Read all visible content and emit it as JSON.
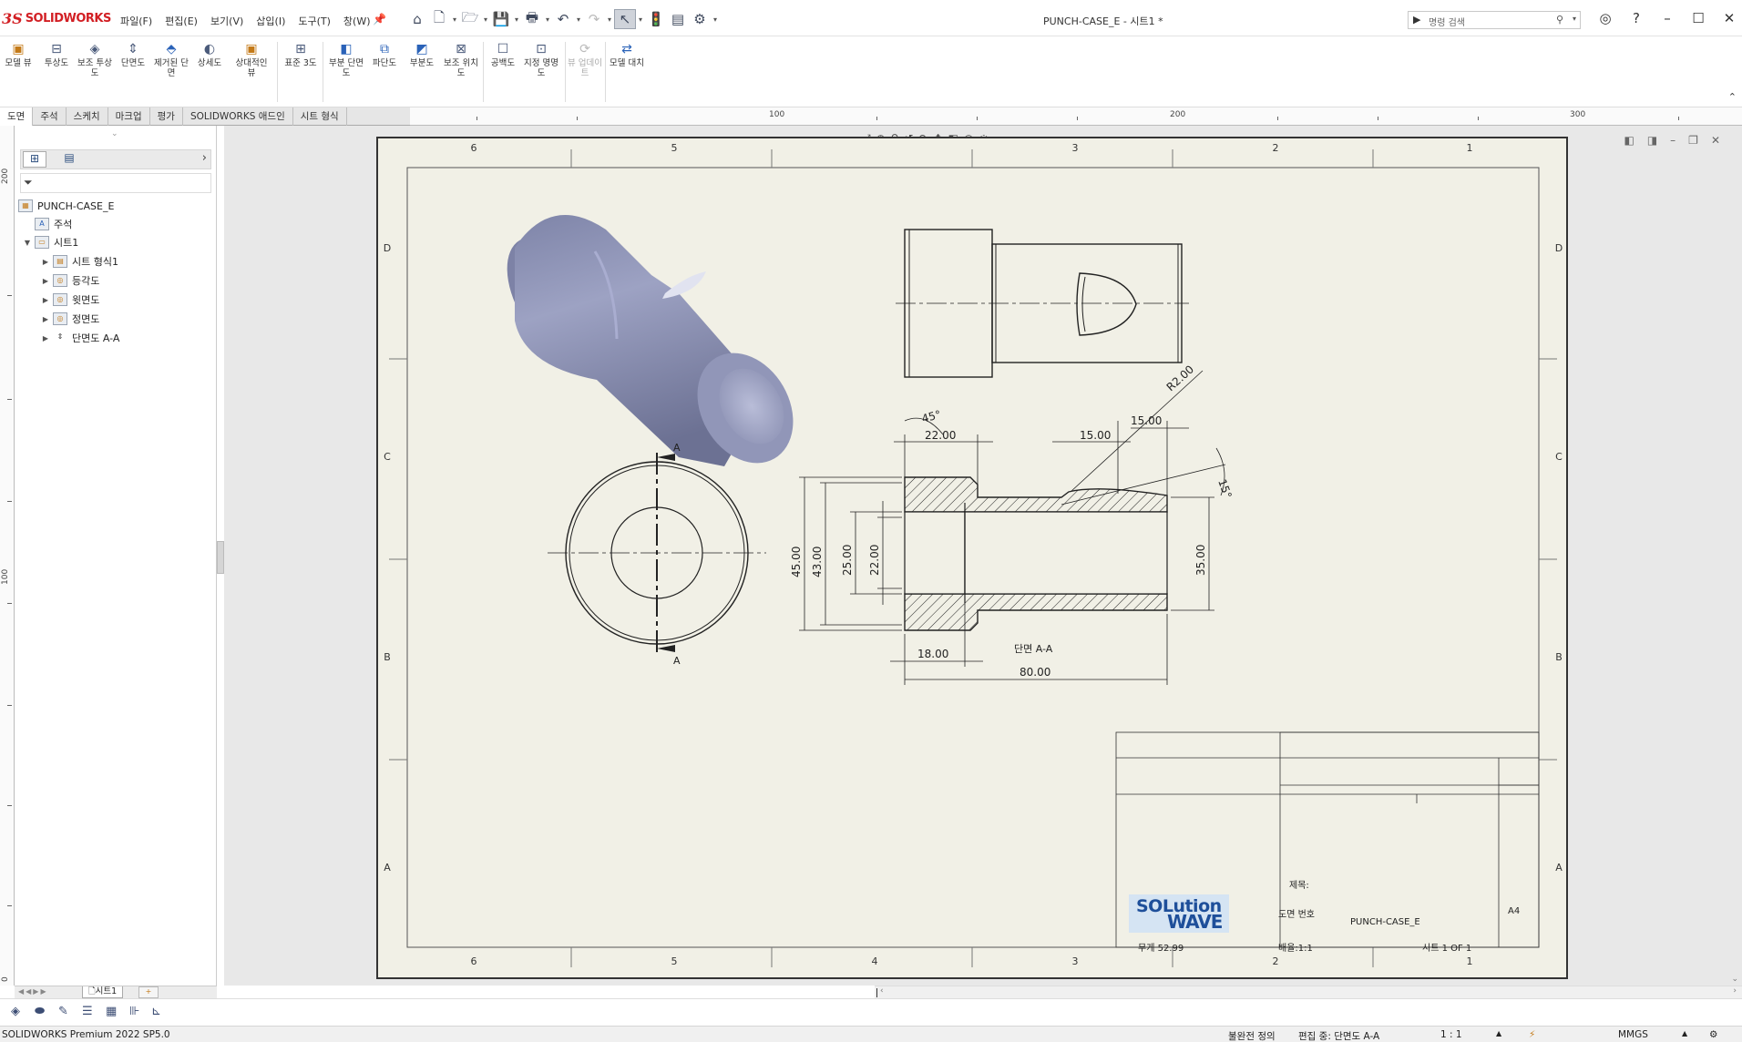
{
  "app": {
    "brand_prefix": "3S",
    "brand_name": "SOLIDWORKS",
    "menu": [
      "파일(F)",
      "편집(E)",
      "보기(V)",
      "삽입(I)",
      "도구(T)",
      "창(W)"
    ],
    "doc_title": "PUNCH-CASE_E - 시트1 *",
    "search_placeholder": "명령 검색"
  },
  "ribbon": {
    "buttons": [
      {
        "label": "모델 뷰",
        "icon": "model-view-icon"
      },
      {
        "label": "투상도",
        "icon": "projected-view-icon"
      },
      {
        "label": "보조 투상도",
        "icon": "auxiliary-view-icon"
      },
      {
        "label": "단면도",
        "icon": "section-view-icon"
      },
      {
        "label": "제거된 단면",
        "icon": "removed-section-icon"
      },
      {
        "label": "상세도",
        "icon": "detail-view-icon"
      },
      {
        "label": "상대적인 뷰",
        "icon": "relative-view-icon"
      },
      {
        "label": "표준 3도",
        "icon": "standard-3-view-icon"
      },
      {
        "label": "부분 단면도",
        "icon": "broken-out-section-icon"
      },
      {
        "label": "파단도",
        "icon": "break-icon"
      },
      {
        "label": "부분도",
        "icon": "crop-view-icon"
      },
      {
        "label": "보조 위치도",
        "icon": "alternate-position-icon"
      },
      {
        "label": "공백도",
        "icon": "empty-view-icon"
      },
      {
        "label": "지정 명명도",
        "icon": "predefined-view-icon"
      },
      {
        "label": "뷰 업데이트",
        "icon": "update-view-icon",
        "disabled": true
      },
      {
        "label": "모델 대치",
        "icon": "replace-model-icon"
      }
    ]
  },
  "tabs": [
    "도면",
    "주석",
    "스케치",
    "마크업",
    "평가",
    "SOLIDWORKS 애드인",
    "시트 형식"
  ],
  "active_tab": "도면",
  "ruler": {
    "h_labels": [
      "100",
      "200",
      "300"
    ],
    "v_labels": [
      "200",
      "100",
      "0"
    ]
  },
  "tree": {
    "root": "PUNCH-CASE_E",
    "items": [
      {
        "label": "주석",
        "level": 1,
        "expand": ""
      },
      {
        "label": "시트1",
        "level": 1,
        "expand": "▼"
      },
      {
        "label": "시트 형식1",
        "level": 2,
        "expand": "▶"
      },
      {
        "label": "등각도",
        "level": 2,
        "expand": "▶"
      },
      {
        "label": "윗면도",
        "level": 2,
        "expand": "▶"
      },
      {
        "label": "정면도",
        "level": 2,
        "expand": "▶"
      },
      {
        "label": "단면도 A-A",
        "level": 2,
        "expand": "▶"
      }
    ],
    "sheet_tab": "시트1"
  },
  "drawing": {
    "zone_columns": [
      "6",
      "5",
      "4",
      "3",
      "2",
      "1"
    ],
    "zone_rows": [
      "D",
      "C",
      "B",
      "A"
    ],
    "section_marker": "A",
    "section_label": "단면 A-A",
    "dimensions": {
      "chamfer": "45°",
      "d22_top": "22.00",
      "d15_a": "15.00",
      "d15_b": "15.00",
      "r2": "R2.00",
      "angle15": "15°",
      "d45": "45.00",
      "d43": "43.00",
      "d25": "25.00",
      "d22": "22.00",
      "d35": "35.00",
      "d18": "18.00",
      "d80": "80.00"
    },
    "title_block": {
      "title_label": "제목:",
      "drawing_no_label": "도면 번호",
      "drawing_no": "PUNCH-CASE_E",
      "size": "A4",
      "weight": "무게 52.99",
      "scale": "배율:1:1",
      "sheet": "시트 1 OF 1",
      "logo_line1": "SOLution",
      "logo_line2": "WAVE"
    }
  },
  "status": {
    "product": "SOLIDWORKS Premium 2022 SP5.0",
    "definition": "불완전 정의",
    "editing": "편집 중: 단면도 A-A",
    "scale": "1 : 1",
    "units": "MMGS"
  },
  "colors": {
    "sheet_bg": "#f1f0e6",
    "model_shade": "#8e93b5",
    "brand_red": "#d21f24"
  }
}
